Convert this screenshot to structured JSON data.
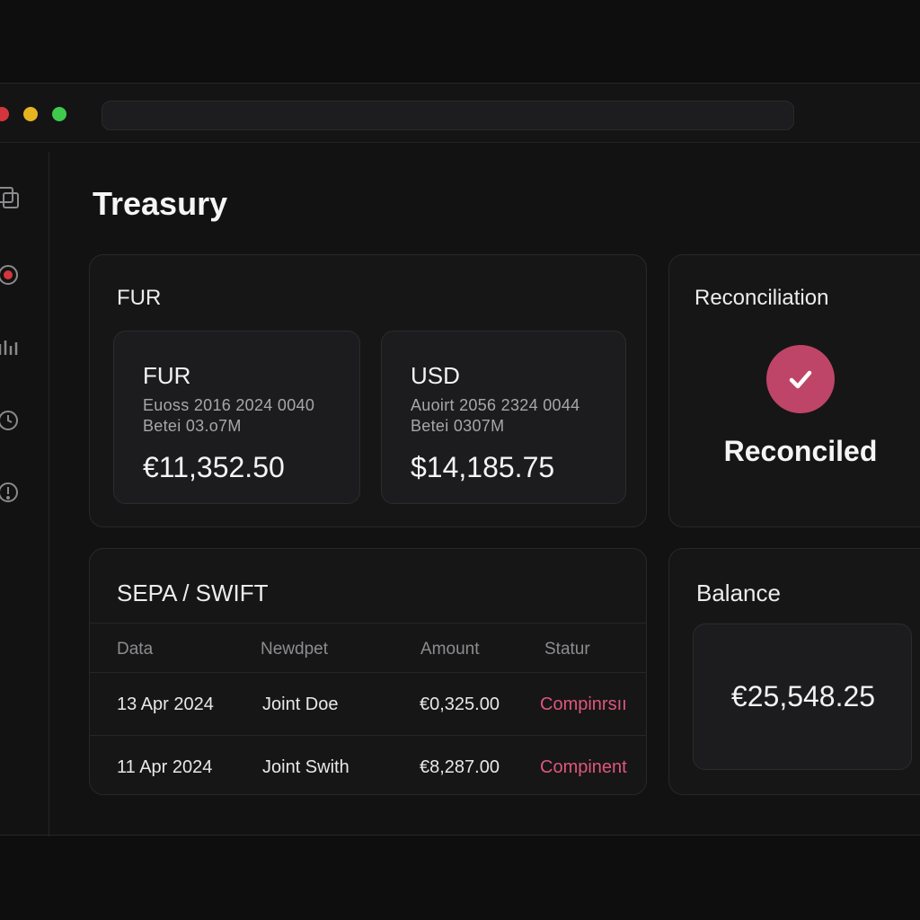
{
  "page": {
    "title": "Treasury"
  },
  "currencies_card": {
    "title": "FUR",
    "accounts": [
      {
        "code": "FUR",
        "line1": "Euoss 2016  2024 0040",
        "line2": "Betei 03.o7M",
        "amount": "€11,352.50"
      },
      {
        "code": "USD",
        "line1": "Auoirt 2056  2324 0044",
        "line2": "Betei 0307M",
        "amount": "$14,185.75"
      }
    ]
  },
  "reconciliation": {
    "title": "Reconciliation",
    "status": "Reconciled"
  },
  "payments": {
    "title": "SEPA / SWIFT",
    "columns": [
      "Data",
      "Newdpet",
      "Amount",
      "Statur"
    ],
    "rows": [
      {
        "date": "13 Apr 2024",
        "name": "Joint Doe",
        "amount": "€0,325.00",
        "status": "Compinrsıı"
      },
      {
        "date": "11 Apr 2024",
        "name": "Joint Swith",
        "amount": "€8,287.00",
        "status": "Compinent"
      }
    ]
  },
  "balance": {
    "title": "Balance",
    "amount": "€25,548.25"
  },
  "colors": {
    "accent": "#bf4568",
    "status": "#e0567c",
    "background": "#0e0e0f"
  },
  "sidebar_icons": [
    "layers-icon",
    "target-icon",
    "bar-chart-icon",
    "history-icon",
    "info-icon"
  ]
}
